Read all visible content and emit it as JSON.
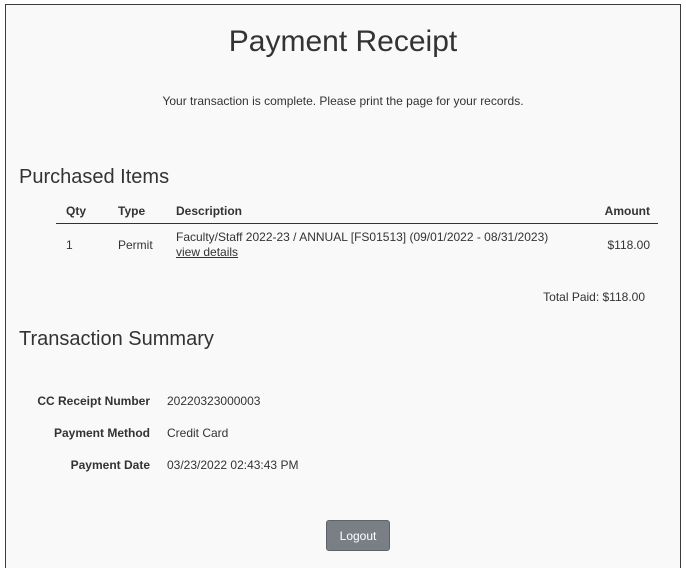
{
  "header": {
    "title": "Payment Receipt",
    "notice": "Your transaction is complete. Please print the page for your records."
  },
  "purchased_items": {
    "section_title": "Purchased Items",
    "columns": {
      "qty": "Qty",
      "type": "Type",
      "description": "Description",
      "amount": "Amount"
    },
    "rows": [
      {
        "qty": "1",
        "type": "Permit",
        "description": "Faculty/Staff 2022-23 / ANNUAL [FS01513] (09/01/2022 - 08/31/2023)",
        "link_label": "view details",
        "amount": "$118.00"
      }
    ],
    "total_paid": "Total Paid: $118.00"
  },
  "transaction_summary": {
    "section_title": "Transaction Summary",
    "fields": [
      {
        "label": "CC Receipt Number",
        "value": "20220323000003"
      },
      {
        "label": "Payment Method",
        "value": "Credit Card"
      },
      {
        "label": "Payment Date",
        "value": "03/23/2022 02:43:43 PM"
      }
    ]
  },
  "actions": {
    "logout_label": "Logout"
  },
  "colors": {
    "background": "#f9f9f9",
    "text": "#333333",
    "button": "#7a7f86"
  }
}
